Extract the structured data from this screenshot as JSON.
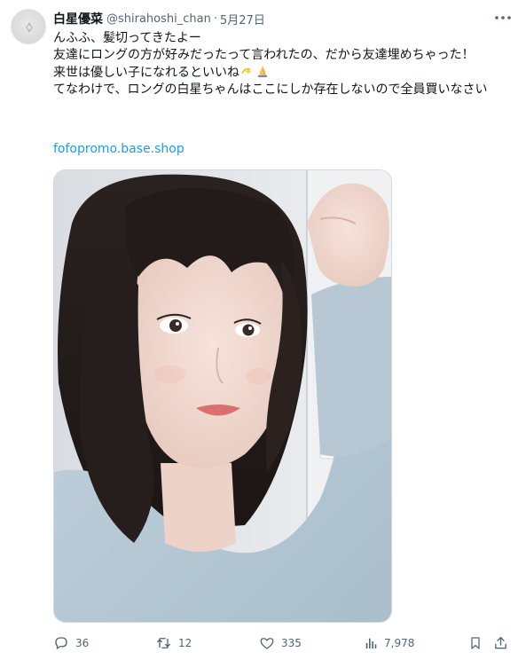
{
  "tweet": {
    "display_name": "白星優菜",
    "handle": "@shirahoshi_chan",
    "separator": "·",
    "date": "5月27日",
    "lines": [
      "んふふ、髪切ってきたよー",
      "友達にロングの方が好みだったって言われたの、だから友達埋めちゃった！",
      "来世は優しい子になれるといいね",
      "てなわけで、ロングの白星ちゃんはここにしか存在しないので全員買いなさい"
    ],
    "link": "fofopromo.base.shop",
    "emoji_icons": [
      "dizzy-icon",
      "folded-hands-icon"
    ]
  },
  "stats": {
    "replies": "36",
    "reposts": "12",
    "likes": "335",
    "views": "7,978"
  },
  "icons": {
    "more": "more-options-icon",
    "reply": "reply-icon",
    "repost": "repost-icon",
    "like": "heart-icon",
    "views": "views-chart-icon",
    "bookmark": "bookmark-icon",
    "share": "share-icon"
  },
  "colors": {
    "text": "#0f1419",
    "secondary": "#536471",
    "link": "#1d9bf0",
    "border": "#cfd9de"
  }
}
